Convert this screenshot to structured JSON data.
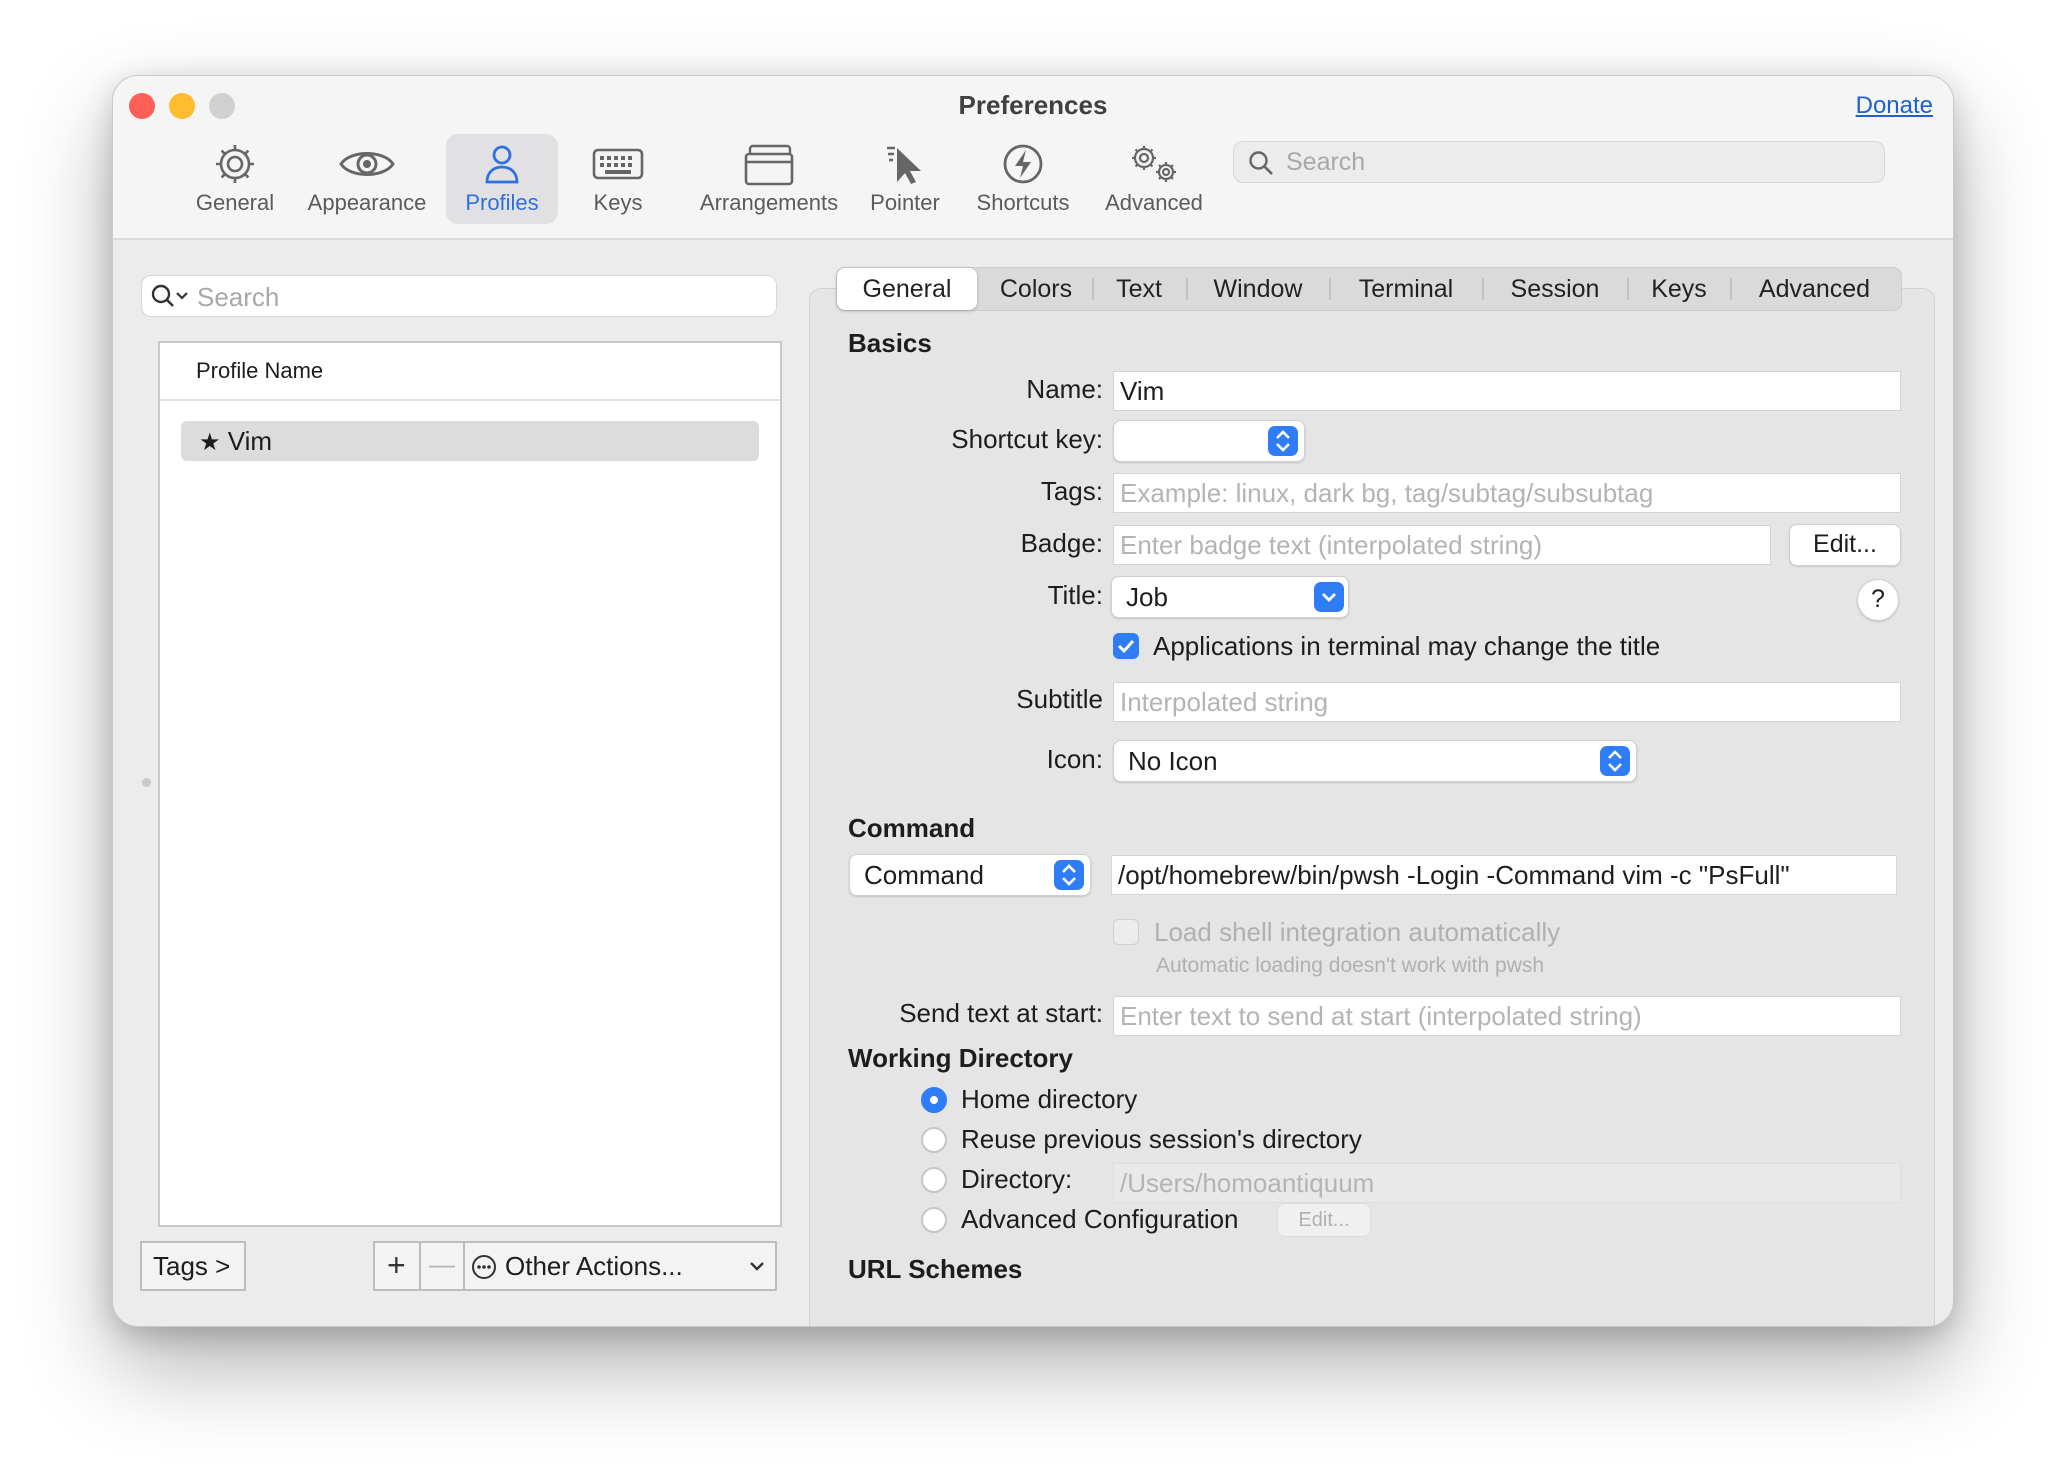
{
  "window": {
    "title": "Preferences",
    "donate": "Donate",
    "colors": {
      "close": "#fe5f57",
      "minimize": "#febc2e",
      "maximize": "#d0d0d0",
      "accent": "#2f7df6"
    }
  },
  "toolbar": {
    "items": [
      {
        "label": "General",
        "icon": "gear-icon"
      },
      {
        "label": "Appearance",
        "icon": "eye-icon"
      },
      {
        "label": "Profiles",
        "icon": "person-icon",
        "selected": true
      },
      {
        "label": "Keys",
        "icon": "keyboard-icon"
      },
      {
        "label": "Arrangements",
        "icon": "window-stack-icon"
      },
      {
        "label": "Pointer",
        "icon": "pointer-icon"
      },
      {
        "label": "Shortcuts",
        "icon": "bolt-icon"
      },
      {
        "label": "Advanced",
        "icon": "gears-icon"
      }
    ],
    "search_placeholder": "Search"
  },
  "profiles": {
    "search_placeholder": "Search",
    "column_header": "Profile Name",
    "rows": [
      {
        "name": "Vim",
        "default": true
      }
    ],
    "tags_button": "Tags >",
    "add": "+",
    "remove": "—",
    "other_actions": "Other Actions..."
  },
  "tabs": [
    "General",
    "Colors",
    "Text",
    "Window",
    "Terminal",
    "Session",
    "Keys",
    "Advanced"
  ],
  "basics": {
    "heading": "Basics",
    "name_label": "Name:",
    "name_value": "Vim",
    "shortcut_label": "Shortcut key:",
    "shortcut_value": "",
    "tags_label": "Tags:",
    "tags_placeholder": "Example: linux, dark bg, tag/subtag/subsubtag",
    "badge_label": "Badge:",
    "badge_placeholder": "Enter badge text (interpolated string)",
    "badge_edit": "Edit...",
    "title_label": "Title:",
    "title_value": "Job",
    "help": "?",
    "apps_change_title": "Applications in terminal may change the title",
    "apps_change_title_checked": true,
    "subtitle_label": "Subtitle",
    "subtitle_placeholder": "Interpolated string",
    "icon_label": "Icon:",
    "icon_value": "No Icon"
  },
  "command": {
    "heading": "Command",
    "mode": "Command",
    "value": "/opt/homebrew/bin/pwsh -Login -Command vim -c \"PsFull\"",
    "load_shell": "Load shell integration automatically",
    "load_shell_note": "Automatic loading doesn't work with pwsh",
    "send_text_label": "Send text at start:",
    "send_text_placeholder": "Enter text to send at start (interpolated string)"
  },
  "working_directory": {
    "heading": "Working Directory",
    "options": [
      "Home directory",
      "Reuse previous session's directory",
      "Directory:",
      "Advanced Configuration"
    ],
    "selected": "Home directory",
    "directory_placeholder": "/Users/homoantiquum",
    "advanced_edit": "Edit..."
  },
  "url_schemes": {
    "heading": "URL Schemes"
  }
}
